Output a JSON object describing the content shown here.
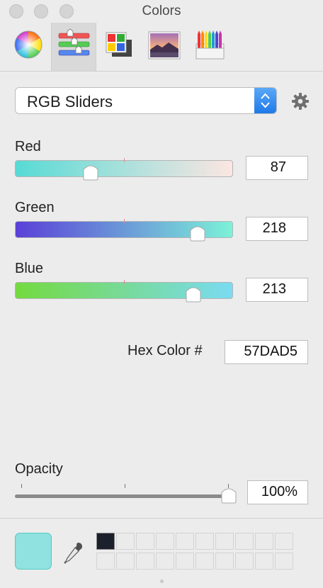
{
  "window": {
    "title": "Colors"
  },
  "toolbar": {
    "tools": [
      {
        "icon": "color-wheel-icon"
      },
      {
        "icon": "color-sliders-icon",
        "selected": true
      },
      {
        "icon": "color-palettes-icon"
      },
      {
        "icon": "image-palettes-icon"
      },
      {
        "icon": "pencils-icon"
      }
    ]
  },
  "mode_popup": {
    "selected": "RGB Sliders"
  },
  "sliders": [
    {
      "label": "Red",
      "value": "87",
      "fraction": 0.341,
      "gradient_from": "#57dad5",
      "gradient_to": "#fce6e2"
    },
    {
      "label": "Green",
      "value": "218",
      "fraction": 0.855,
      "gradient_from": "#5a3fd8",
      "gradient_to": "#7cf2d8"
    },
    {
      "label": "Blue",
      "value": "213",
      "fraction": 0.835,
      "gradient_from": "#74da3f",
      "gradient_to": "#7adbf2"
    }
  ],
  "hex": {
    "label": "Hex Color #",
    "value": "57DAD5"
  },
  "opacity": {
    "label": "Opacity",
    "value": "100%",
    "fraction": 1.0
  },
  "current_color": "#8fe2df",
  "swatches": {
    "filled_color": "#1c1f2c",
    "columns": 10,
    "rows": 2
  }
}
